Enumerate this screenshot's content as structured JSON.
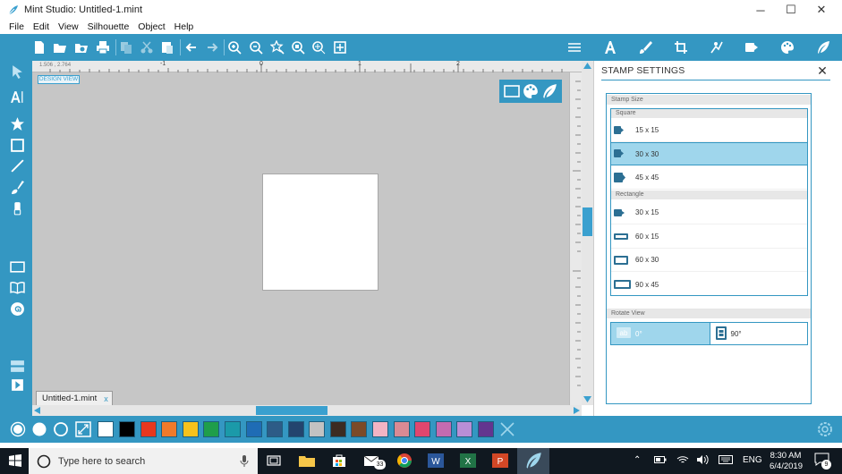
{
  "window": {
    "title": "Mint Studio: Untitled-1.mint",
    "minimize_label": "─",
    "maximize_label": "☐",
    "close_label": "✕"
  },
  "menu": [
    "File",
    "Edit",
    "View",
    "Silhouette",
    "Object",
    "Help"
  ],
  "toolbar": {
    "left_icons": [
      "new-file-icon",
      "open-folder-icon",
      "open-recent-icon",
      "print-icon",
      "copy-icon",
      "cut-icon",
      "paste-icon",
      "undo-icon",
      "redo-icon",
      "zoom-in-icon",
      "zoom-out-icon",
      "zoom-select-icon",
      "zoom-fit-icon",
      "zoom-drag-icon",
      "fit-page-icon"
    ],
    "right_icons": [
      "grid-lines-icon",
      "text-style-icon",
      "brush-icon",
      "crop-icon",
      "trace-icon",
      "stamp-settings-icon",
      "palette-icon",
      "feather-icon"
    ]
  },
  "left_tools": [
    "select-arrow-icon",
    "text-tool-icon",
    "star-shape-icon",
    "rectangle-shape-icon",
    "line-tool-icon",
    "pen-tool-icon",
    "eraser-icon",
    "page-view-icon",
    "book-icon",
    "spiral-icon",
    "layers-icon",
    "play-icon"
  ],
  "canvas": {
    "design_view_label": "DESIGN VIEW",
    "ruler_readout": "1.506 , 2.764",
    "ruler_numbers": [
      "-1",
      "0",
      "1",
      "2"
    ],
    "background_color": "#c6c6c6"
  },
  "doc_tab": {
    "label": "Untitled-1.mint",
    "close": "x"
  },
  "panel": {
    "title": "STAMP SETTINGS",
    "close": "✕",
    "stamp_size_label": "Stamp Size",
    "square_label": "Square",
    "rectangle_label": "Rectangle",
    "square_sizes": [
      "15 x 15",
      "30 x 30",
      "45 x 45"
    ],
    "rectangle_sizes": [
      "30 x 15",
      "60 x 15",
      "60 x 30",
      "90 x 45"
    ],
    "selected_size": "30 x 30",
    "rotate_view_label": "Rotate View",
    "rotate_options": [
      {
        "badge": "ab",
        "label": "0°"
      },
      {
        "badge": "ab",
        "label": "90°"
      }
    ],
    "selected_rotate": "0°"
  },
  "palette": [
    "#ffffff",
    "#000000",
    "#e8371e",
    "#f07a2b",
    "#f6c21b",
    "#1f9e4a",
    "#1b9aa9",
    "#1f6cb5",
    "#2d5c87",
    "#23446e",
    "#c2c2c2",
    "#3c2b22",
    "#7b4a28",
    "#f2b4c4",
    "#d98a94",
    "#e0466e",
    "#c46bb0",
    "#b98ed6",
    "#63358f"
  ],
  "accent": "#3497c2",
  "taskbar": {
    "search_placeholder": "Type here to search",
    "mail_badge": "33",
    "language": "ENG",
    "time": "8:30 AM",
    "date": "6/4/2019",
    "notifications": "9"
  }
}
